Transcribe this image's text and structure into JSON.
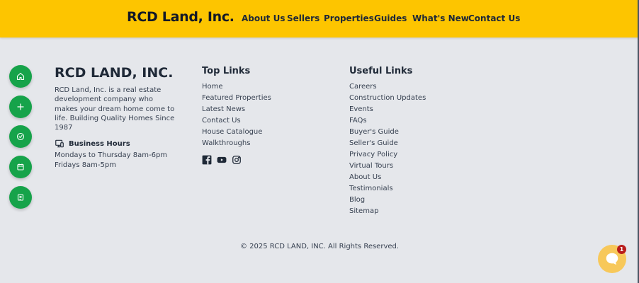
{
  "header": {
    "brand": "RCD Land, Inc.",
    "nav": [
      "About Us",
      "Sellers",
      "Properties",
      "Guides",
      "What's New",
      "Contact Us"
    ],
    "background_color": "#fdc500"
  },
  "floating_actions": [
    {
      "icon": "home-icon"
    },
    {
      "icon": "plus-icon"
    },
    {
      "icon": "check-circle-icon"
    },
    {
      "icon": "calendar-icon"
    },
    {
      "icon": "document-icon"
    }
  ],
  "footer": {
    "company": {
      "title": "RCD LAND, INC.",
      "description": "RCD Land, Inc. is a real estate development company who makes your dream home come to life. Building Quality Homes Since 1987",
      "hours_title": "Business Hours",
      "hours": [
        "Mondays to Thursday 8am-6pm",
        "Fridays 8am-5pm"
      ]
    },
    "top_links": {
      "title": "Top Links",
      "items": [
        "Home",
        "Featured Properties",
        "Latest News",
        "Contact Us",
        "House Catalogue",
        "Walkthroughs"
      ]
    },
    "social": [
      "facebook-icon",
      "youtube-icon",
      "instagram-icon"
    ],
    "useful_links": {
      "title": "Useful Links",
      "items": [
        "Careers",
        "Construction Updates",
        "Events",
        "FAQs",
        "Buyer's Guide",
        "Seller's Guide",
        "Privacy Policy",
        "Virtual Tours",
        "About Us",
        "Testimonials",
        "Blog",
        "Sitemap"
      ]
    },
    "copyright": "© 2025 RCD LAND, INC. All Rights Reserved."
  },
  "chat": {
    "icon": "chat-bubble-icon",
    "badge": "1"
  },
  "colors": {
    "accent_green": "#16a34a",
    "page_background": "#e5e7eb",
    "badge_red": "#b91c1c"
  }
}
